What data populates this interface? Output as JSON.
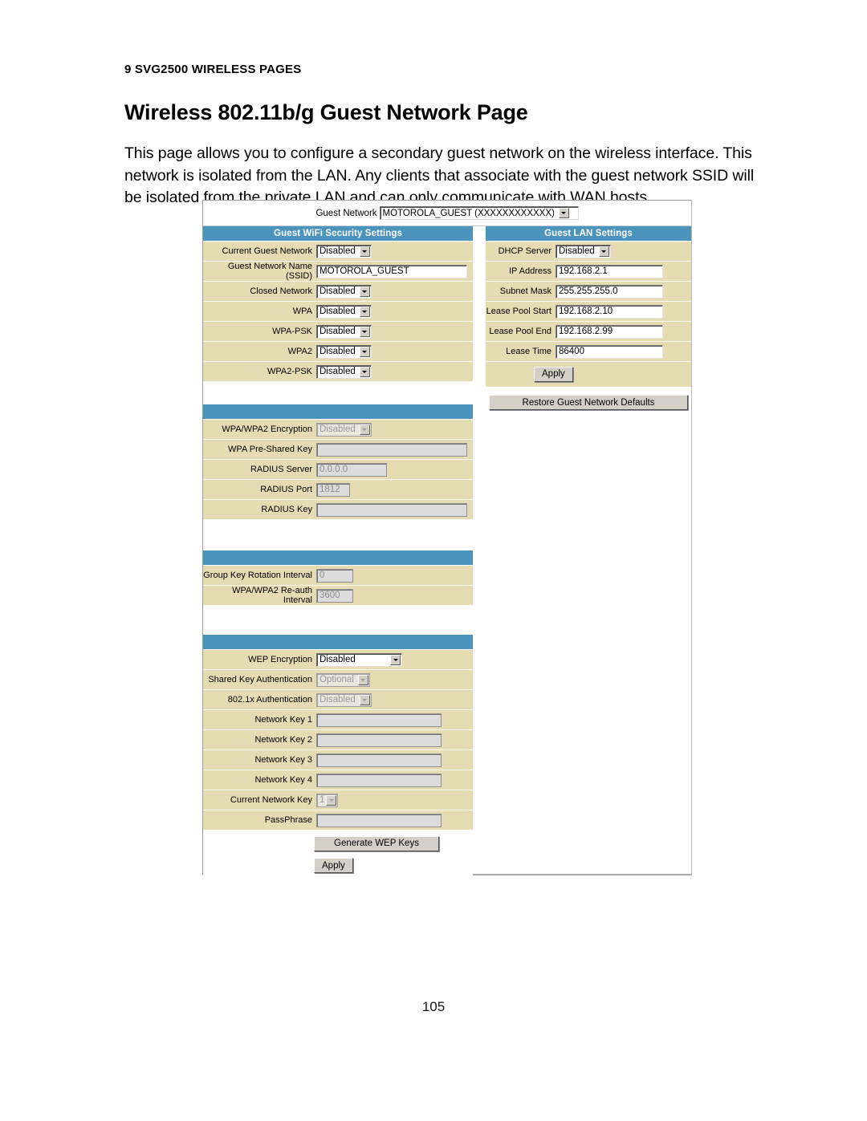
{
  "document": {
    "running_head": "9 SVG2500 WIRELESS PAGES",
    "title": "Wireless 802.11b/g Guest Network Page",
    "paragraph": "This page allows you to configure a secondary guest network on the wireless interface. This network is isolated from the LAN. Any clients that associate with the guest network SSID will be isolated from the private LAN and can only communicate with WAN hosts.",
    "page_number": "105"
  },
  "colors": {
    "section_header": "#4a94bd",
    "row_background": "#e5dcb4",
    "panel_background": "#ffffff",
    "disabled_field": "#dcdcdc"
  },
  "screenshot": {
    "top": {
      "label": "Guest Network",
      "selected": "MOTOROLA_GUEST (XXXXXXXXXXXX)",
      "icon": "chevron-down-icon"
    },
    "wifi_security": {
      "header": "Guest WiFi Security Settings",
      "rows": [
        {
          "label": "Current Guest Network",
          "type": "select",
          "value": "Disabled",
          "disabled": false
        },
        {
          "label": "Guest Network Name (SSID)",
          "type": "text",
          "value": "MOTOROLA_GUEST",
          "disabled": false
        },
        {
          "label": "Closed Network",
          "type": "select",
          "value": "Disabled",
          "disabled": false
        },
        {
          "label": "WPA",
          "type": "select",
          "value": "Disabled",
          "disabled": false
        },
        {
          "label": "WPA-PSK",
          "type": "select",
          "value": "Disabled",
          "disabled": false
        },
        {
          "label": "WPA2",
          "type": "select",
          "value": "Disabled",
          "disabled": false
        },
        {
          "label": "WPA2-PSK",
          "type": "select",
          "value": "Disabled",
          "disabled": false
        }
      ]
    },
    "wpa_section": {
      "header": "",
      "rows": [
        {
          "label": "WPA/WPA2 Encryption",
          "type": "select",
          "value": "Disabled",
          "disabled": true
        },
        {
          "label": "WPA Pre-Shared Key",
          "type": "text",
          "value": "",
          "disabled": true
        },
        {
          "label": "RADIUS Server",
          "type": "text",
          "value": "0.0.0.0",
          "disabled": true
        },
        {
          "label": "RADIUS Port",
          "type": "text",
          "value": "1812",
          "disabled": true
        },
        {
          "label": "RADIUS Key",
          "type": "text",
          "value": "",
          "disabled": true
        }
      ]
    },
    "interval_section": {
      "header": "",
      "rows": [
        {
          "label": "Group Key Rotation Interval",
          "type": "text",
          "value": "0",
          "disabled": true
        },
        {
          "label": "WPA/WPA2 Re-auth Interval",
          "type": "text",
          "value": "3600",
          "disabled": true
        }
      ]
    },
    "wep_section": {
      "header": "",
      "rows": [
        {
          "label": "WEP Encryption",
          "type": "select",
          "value": "Disabled",
          "disabled": false
        },
        {
          "label": "Shared Key Authentication",
          "type": "select",
          "value": "Optional",
          "disabled": true
        },
        {
          "label": "802.1x Authentication",
          "type": "select",
          "value": "Disabled",
          "disabled": true
        },
        {
          "label": "Network Key 1",
          "type": "text",
          "value": "",
          "disabled": true
        },
        {
          "label": "Network Key 2",
          "type": "text",
          "value": "",
          "disabled": true
        },
        {
          "label": "Network Key 3",
          "type": "text",
          "value": "",
          "disabled": true
        },
        {
          "label": "Network Key 4",
          "type": "text",
          "value": "",
          "disabled": true
        },
        {
          "label": "Current Network Key",
          "type": "select",
          "value": "1",
          "disabled": true
        },
        {
          "label": "PassPhrase",
          "type": "text",
          "value": "",
          "disabled": true
        }
      ],
      "generate_button": "Generate WEP Keys",
      "apply_button": "Apply"
    },
    "lan_settings": {
      "header": "Guest LAN Settings",
      "rows": [
        {
          "label": "DHCP Server",
          "type": "select",
          "value": "Disabled",
          "disabled": false
        },
        {
          "label": "IP Address",
          "type": "text",
          "value": "192.168.2.1",
          "disabled": false
        },
        {
          "label": "Subnet Mask",
          "type": "text",
          "value": "255.255.255.0",
          "disabled": false
        },
        {
          "label": "Lease Pool Start",
          "type": "text",
          "value": "192.168.2.10",
          "disabled": false
        },
        {
          "label": "Lease Pool End",
          "type": "text",
          "value": "192.168.2.99",
          "disabled": false
        },
        {
          "label": "Lease Time",
          "type": "text",
          "value": "86400",
          "disabled": false
        }
      ],
      "apply_button": "Apply",
      "restore_button": "Restore Guest Network Defaults"
    }
  }
}
